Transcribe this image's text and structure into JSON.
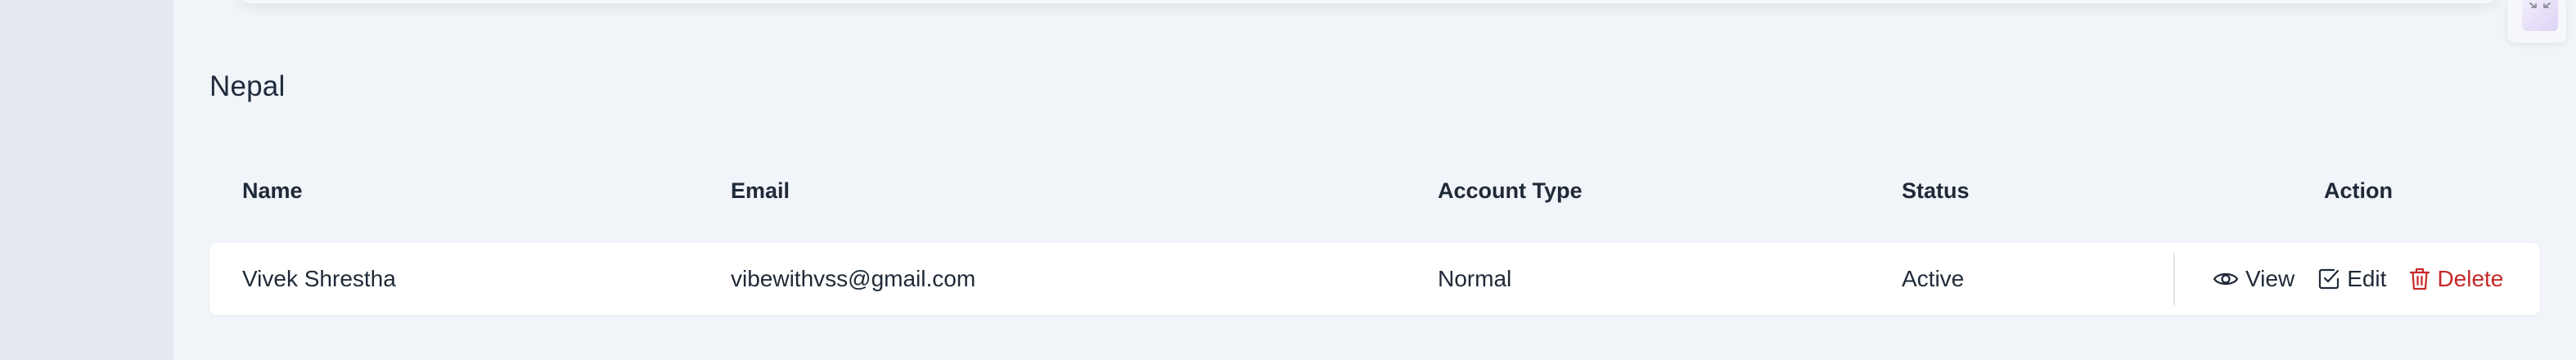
{
  "section": {
    "title": "Nepal"
  },
  "table": {
    "columns": [
      "Name",
      "Email",
      "Account Type",
      "Status",
      "Action"
    ],
    "rows": [
      {
        "name": "Vivek Shrestha",
        "email": "vibewithvss@gmail.com",
        "account_type": "Normal",
        "status": "Active"
      }
    ],
    "actions": {
      "view_label": "View",
      "edit_label": "Edit",
      "delete_label": "Delete"
    }
  },
  "icons": {
    "view": "eye-icon",
    "edit": "edit-check-icon",
    "delete": "trash-icon",
    "corner": "collapse-arrows-icon"
  },
  "colors": {
    "delete": "#c62828",
    "background": "#f1f4f9",
    "sidebar": "#e5e8ef",
    "row": "#ffffff"
  }
}
